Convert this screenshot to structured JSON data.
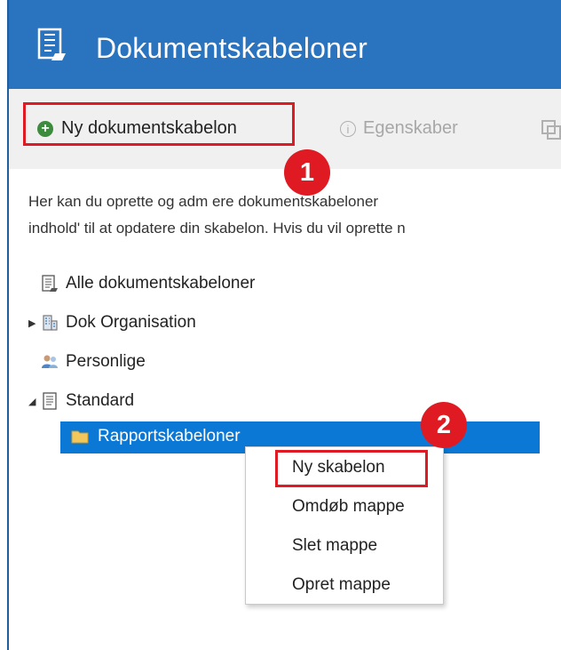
{
  "header": {
    "title": "Dokumentskabeloner",
    "icon": "document-template-icon"
  },
  "toolbar": {
    "new_label": "Ny dokumentskabelon",
    "properties_label": "Egenskaber"
  },
  "intro": {
    "line1": "Her kan du oprette og adm    ere dokumentskabeloner",
    "line2": "indhold' til at opdatere din skabelon. Hvis du vil oprette n"
  },
  "tree": {
    "items": [
      {
        "label": "Alle dokumentskabeloner",
        "icon": "document-template-icon"
      },
      {
        "label": "Dok Organisation",
        "icon": "building-icon"
      },
      {
        "label": "Personlige",
        "icon": "users-icon"
      },
      {
        "label": "Standard",
        "icon": "document-icon"
      }
    ],
    "selected": {
      "label": "Rapportskabeloner",
      "icon": "folder-icon"
    }
  },
  "context_menu": {
    "items": [
      "Ny skabelon",
      "Omdøb mappe",
      "Slet mappe",
      "Opret mappe"
    ]
  },
  "badges": [
    "1",
    "2"
  ],
  "colors": {
    "header": "#2a73bf",
    "highlight": "#e01a22",
    "selection": "#0a78d4"
  }
}
